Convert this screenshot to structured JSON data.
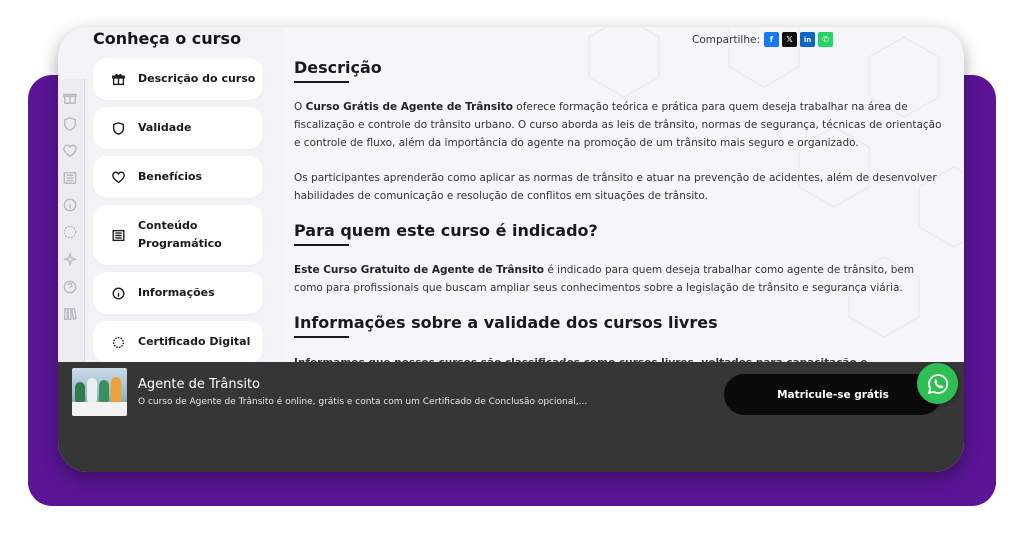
{
  "sidebar": {
    "title": "Conheça o curso",
    "items": [
      {
        "label": "Descrição do curso",
        "icon": "gift-icon"
      },
      {
        "label": "Validade",
        "icon": "shield-icon"
      },
      {
        "label": "Benefícios",
        "icon": "heart-icon"
      },
      {
        "label": "Conteúdo Programático",
        "icon": "list-icon"
      },
      {
        "label": "Informações",
        "icon": "info-icon"
      },
      {
        "label": "Certificado Digital",
        "icon": "certificate-icon"
      }
    ]
  },
  "share": {
    "label": "Compartilhe:",
    "buttons": [
      {
        "icon": "facebook-icon",
        "glyph": "f",
        "color": "#1877f2"
      },
      {
        "icon": "x-icon",
        "glyph": "𝕏",
        "color": "#111111"
      },
      {
        "icon": "linkedin-icon",
        "glyph": "in",
        "color": "#0a66c2"
      },
      {
        "icon": "whatsapp-icon",
        "glyph": "✆",
        "color": "#25d366"
      }
    ]
  },
  "content": {
    "description_heading": "Descrição",
    "description_p1_intro": "O ",
    "description_p1_bold": "Curso Grátis de Agente de Trânsito",
    "description_p1_rest": " oferece formação teórica e prática para quem deseja trabalhar na área de fiscalização e controle do trânsito urbano. O curso aborda as leis de trânsito, normas de segurança, técnicas de orientação e controle de fluxo, além da importância do agente na promoção de um trânsito mais seguro e organizado.",
    "description_p2": "Os participantes aprenderão como aplicar as normas de trânsito e atuar na prevenção de acidentes, além de desenvolver habilidades de comunicação e resolução de conflitos em situações de trânsito.",
    "audience_heading": "Para quem este curso é indicado?",
    "audience_bold": "Este Curso Gratuito de Agente de Trânsito",
    "audience_rest": " é indicado para quem deseja trabalhar como agente de trânsito, bem como para profissionais que buscam ampliar seus conhecimentos sobre a legislação de trânsito e segurança viária.",
    "validity_heading": "Informações sobre a validade dos cursos livres",
    "validity_p_partial": "Informamos que nossos cursos são classificados como cursos livres, voltados para capacitação e aperfeiçoamento"
  },
  "bottom_bar": {
    "course_title": "Agente de Trânsito",
    "course_desc": "O curso de Agente de Trânsito é online, grátis e conta com um Certificado de Conclusão opcional,...",
    "cta_label": "Matricule-se grátis"
  },
  "colors": {
    "purple": "#5b1596",
    "whatsapp": "#2fbe54",
    "bar": "#363636"
  }
}
